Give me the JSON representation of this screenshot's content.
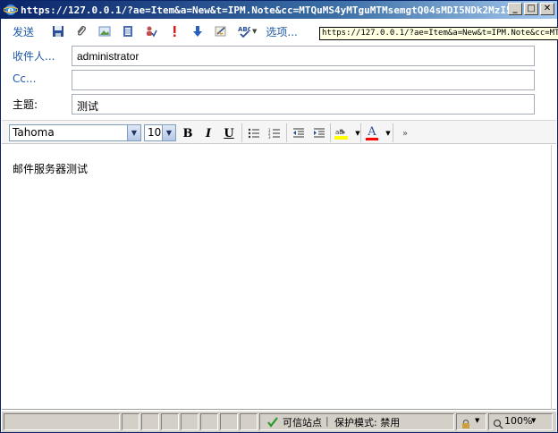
{
  "window": {
    "title": "https://127.0.0.1/?ae=Item&a=New&t=IPM.Note&cc=MTQuMS4yMTguMTMsemgtQ04sMDI5NDk2MzI5MSxI..."
  },
  "tooltip": {
    "text": "https://127.0.0.1/?ae=Item&a=New&t=IPM.Note&cc=MTQ"
  },
  "toolbar": {
    "send_label": "发送",
    "options_label": "选项..."
  },
  "compose": {
    "to_label": "收件人...",
    "to_value": "administrator",
    "cc_label": "Cc...",
    "cc_value": "",
    "subject_label": "主题:",
    "subject_value": "测试"
  },
  "format": {
    "font_name": "Tahoma",
    "font_size": "10",
    "bold": "B",
    "italic": "I",
    "underline": "U",
    "font_color_letter": "A"
  },
  "message": {
    "body": "邮件服务器测试"
  },
  "status": {
    "trusted_site": "可信站点",
    "protected_mode": "保护模式: 禁用",
    "zoom": "100%"
  },
  "colors": {
    "link": "#1e5aa8",
    "titlebar": "#0a246a",
    "highlight": "#ffff00",
    "font_color": "#ff0000"
  }
}
